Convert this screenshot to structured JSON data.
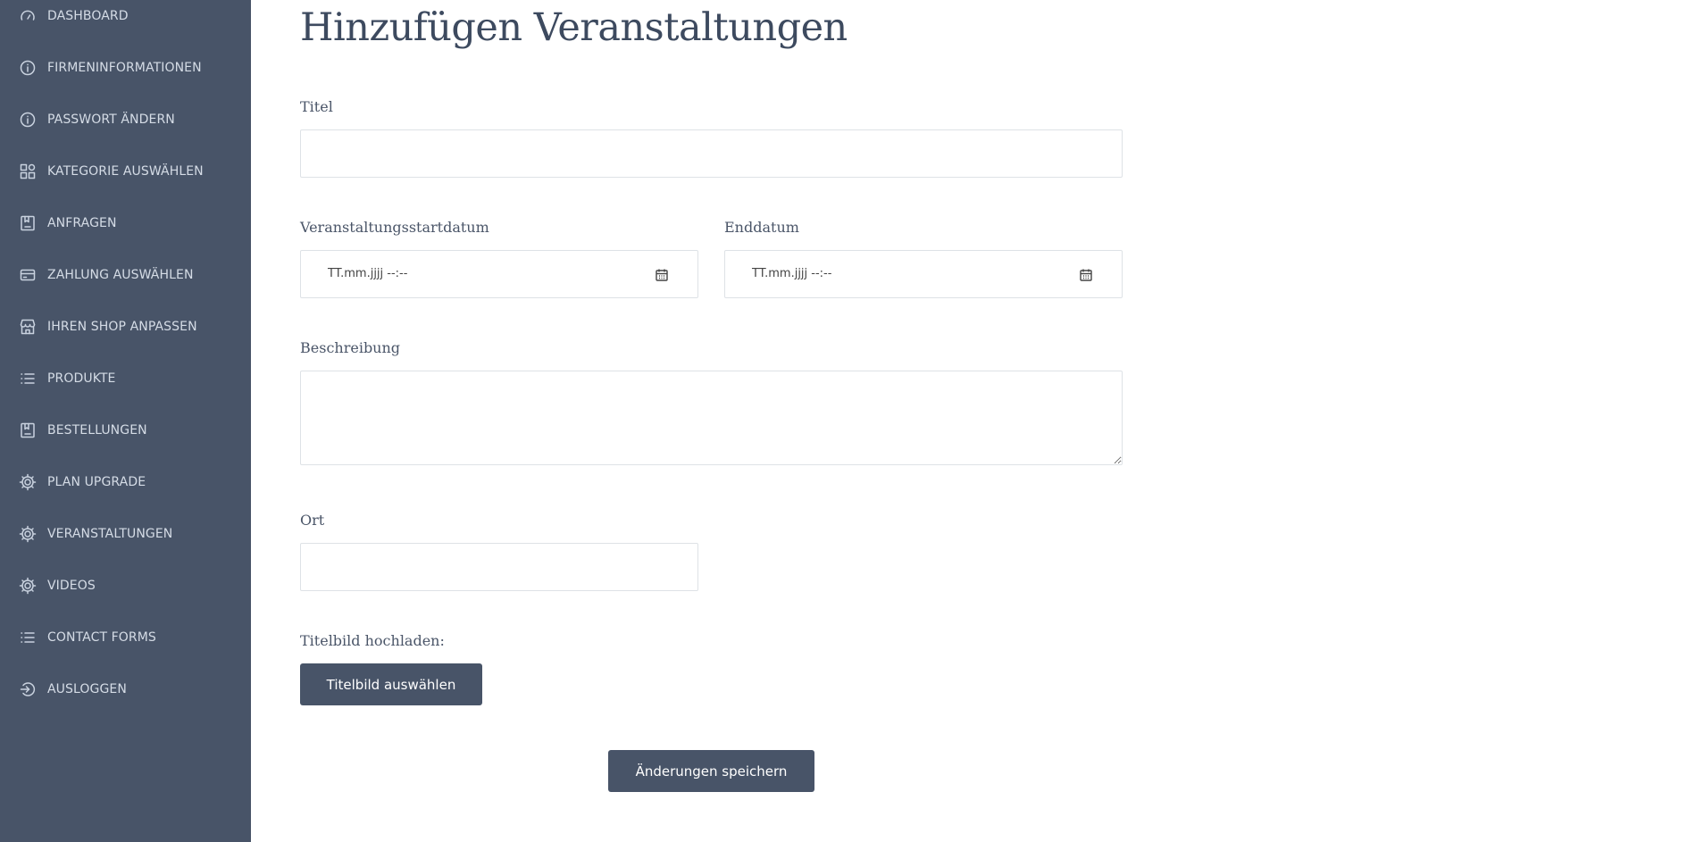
{
  "sidebar": {
    "items": [
      {
        "label": "DASHBOARD",
        "icon": "gauge-icon"
      },
      {
        "label": "FIRMENINFORMATIONEN",
        "icon": "info-icon"
      },
      {
        "label": "PASSWORT ÄNDERN",
        "icon": "info-icon"
      },
      {
        "label": "KATEGORIE AUSWÄHLEN",
        "icon": "category-icon"
      },
      {
        "label": "ANFRAGEN",
        "icon": "bookmark-icon"
      },
      {
        "label": "ZAHLUNG AUSWÄHLEN",
        "icon": "credit-card-icon"
      },
      {
        "label": "IHREN SHOP ANPASSEN",
        "icon": "store-icon"
      },
      {
        "label": "PRODUKTE",
        "icon": "list-icon"
      },
      {
        "label": "BESTELLUNGEN",
        "icon": "bookmark-icon"
      },
      {
        "label": "PLAN UPGRADE",
        "icon": "settings-icon"
      },
      {
        "label": "VERANSTALTUNGEN",
        "icon": "settings-icon"
      },
      {
        "label": "VIDEOS",
        "icon": "settings-icon"
      },
      {
        "label": "CONTACT FORMS",
        "icon": "list-icon"
      },
      {
        "label": "AUSLOGGEN",
        "icon": "logout-icon"
      }
    ]
  },
  "main": {
    "title": "Hinzufügen Veranstaltungen",
    "form": {
      "title_label": "Titel",
      "title_value": "",
      "start_label": "Veranstaltungsstartdatum",
      "start_placeholder": "TT.mm.jjjj --:--",
      "end_label": "Enddatum",
      "end_placeholder": "TT.mm.jjjj --:--",
      "description_label": "Beschreibung",
      "description_value": "",
      "location_label": "Ort",
      "location_value": "",
      "image_label": "Titelbild hochladen:",
      "image_button": "Titelbild auswählen",
      "save_button": "Änderungen speichern"
    }
  },
  "colors": {
    "sidebar_bg": "#485468",
    "sidebar_text": "#d5dce6",
    "button_bg": "#485468",
    "title_text": "#3d4a5f"
  }
}
